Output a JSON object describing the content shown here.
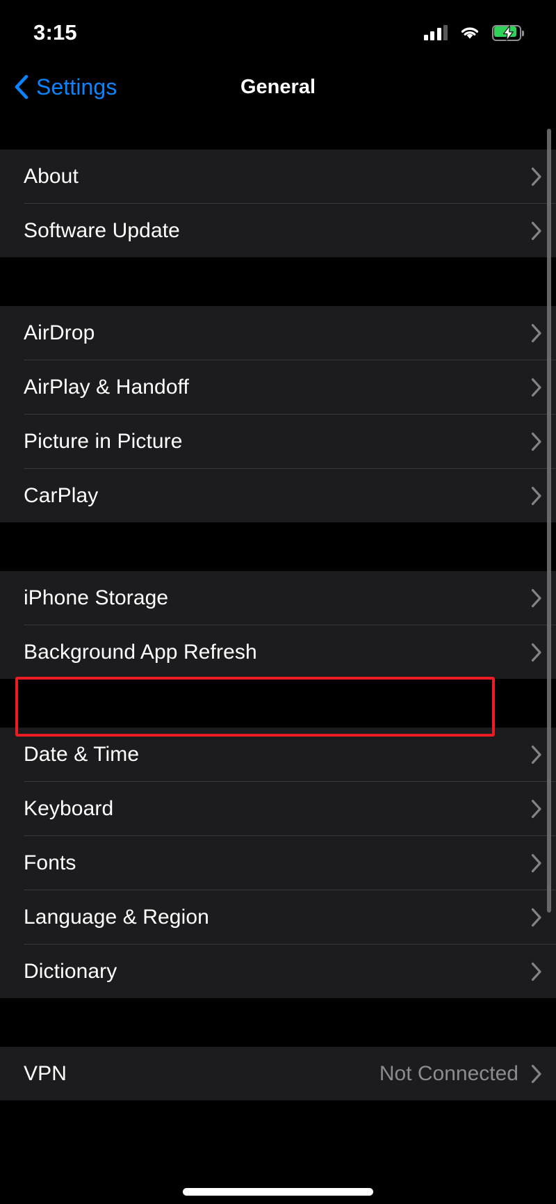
{
  "status_bar": {
    "time": "3:15",
    "cellular_icon": "cellular-signal-icon",
    "cellular_bars_filled": 3,
    "cellular_bars_total": 4,
    "wifi_icon": "wifi-icon",
    "battery_icon": "battery-charging-icon",
    "battery_charging": true,
    "battery_color": "#30d158"
  },
  "nav_bar": {
    "back_icon": "chevron-left-icon",
    "back_label": "Settings",
    "title": "General",
    "accent_color": "#0a84ff"
  },
  "sections": [
    {
      "rows": [
        {
          "label": "About",
          "value": "",
          "chevron": "chevron-right-icon"
        },
        {
          "label": "Software Update",
          "value": "",
          "chevron": "chevron-right-icon"
        }
      ]
    },
    {
      "rows": [
        {
          "label": "AirDrop",
          "value": "",
          "chevron": "chevron-right-icon"
        },
        {
          "label": "AirPlay & Handoff",
          "value": "",
          "chevron": "chevron-right-icon"
        },
        {
          "label": "Picture in Picture",
          "value": "",
          "chevron": "chevron-right-icon"
        },
        {
          "label": "CarPlay",
          "value": "",
          "chevron": "chevron-right-icon"
        }
      ]
    },
    {
      "rows": [
        {
          "label": "iPhone Storage",
          "value": "",
          "chevron": "chevron-right-icon"
        },
        {
          "label": "Background App Refresh",
          "value": "",
          "chevron": "chevron-right-icon",
          "highlighted": true
        }
      ]
    },
    {
      "rows": [
        {
          "label": "Date & Time",
          "value": "",
          "chevron": "chevron-right-icon"
        },
        {
          "label": "Keyboard",
          "value": "",
          "chevron": "chevron-right-icon"
        },
        {
          "label": "Fonts",
          "value": "",
          "chevron": "chevron-right-icon"
        },
        {
          "label": "Language & Region",
          "value": "",
          "chevron": "chevron-right-icon"
        },
        {
          "label": "Dictionary",
          "value": "",
          "chevron": "chevron-right-icon"
        }
      ]
    },
    {
      "rows": [
        {
          "label": "VPN",
          "value": "Not Connected",
          "chevron": "chevron-right-icon"
        }
      ]
    }
  ],
  "annotation": {
    "target_label": "Background App Refresh",
    "color": "#ec1c24"
  },
  "home_indicator": "home-indicator"
}
